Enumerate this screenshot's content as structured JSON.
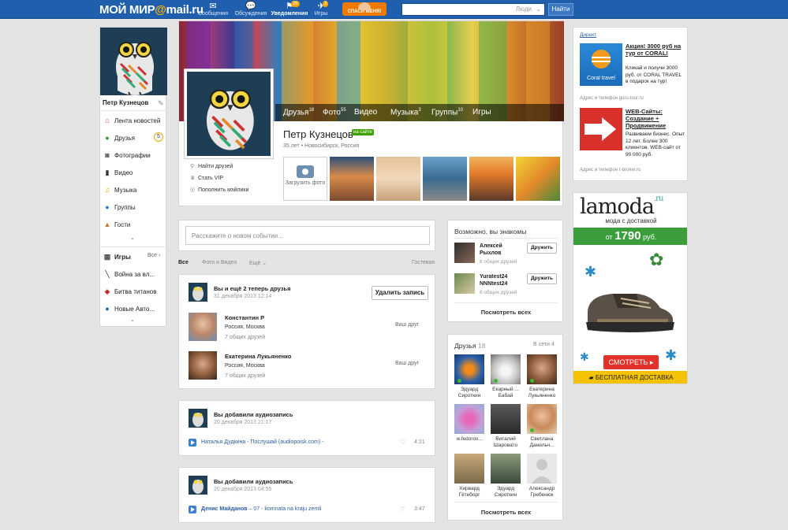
{
  "topbar": {
    "logo_text": "МОЙ МИР",
    "logo_at": "@",
    "logo_domain": "mail.ru",
    "nav": [
      {
        "label": "Сообщения",
        "icon": "message-icon",
        "count": ""
      },
      {
        "label": "Обсуждения",
        "icon": "discussion-icon",
        "count": ""
      },
      {
        "label": "Уведомления",
        "icon": "notification-icon",
        "count": "26"
      },
      {
        "label": "Игры",
        "icon": "games-icon",
        "count": "3"
      }
    ],
    "promo_label": "СПАСИ МЕНЯ!",
    "search_scope": "Люди",
    "search_button": "Найти"
  },
  "left": {
    "name": "Петр Кузнецов",
    "menu": [
      {
        "label": "Лента новостей",
        "icon": "house-icon"
      },
      {
        "label": "Друзья",
        "icon": "friends-icon",
        "count": "5"
      },
      {
        "label": "Фотографии",
        "icon": "camera-icon"
      },
      {
        "label": "Видео",
        "icon": "video-icon"
      },
      {
        "label": "Музыка",
        "icon": "music-icon"
      },
      {
        "label": "Группы",
        "icon": "groups-icon"
      },
      {
        "label": "Гости",
        "icon": "guests-icon"
      }
    ],
    "games_label": "Игры",
    "games_all": "Все",
    "games": [
      "Война за вл...",
      "Битва титанов",
      "Новые Авто..."
    ]
  },
  "profile": {
    "name": "Петр Кузнецов",
    "onsite": "на сайте",
    "info": "35 лет • Новосибирск, Россия",
    "upload_label": "Загрузить фото",
    "links": [
      "Найти друзей",
      "Стать VIP",
      "Пополнить мэйлики"
    ],
    "nav": [
      {
        "label": "Друзья",
        "count": "18"
      },
      {
        "label": "Фото",
        "count": "55"
      },
      {
        "label": "Видео",
        "count": ""
      },
      {
        "label": "Музыка",
        "count": "3"
      },
      {
        "label": "Группы",
        "count": "10"
      },
      {
        "label": "Игры",
        "count": ""
      }
    ]
  },
  "feed": {
    "post_placeholder": "Расскажите о новом событии...",
    "filters": [
      "Все",
      "Фото и Видео",
      "Ещё"
    ],
    "guestbook": "Гостевая",
    "event1": {
      "title": "Вы и ещё 2 теперь друзья",
      "date": "31 декабря 2013 12:14",
      "delete_button": "Удалить запись",
      "friends": [
        {
          "name": "Константин Р",
          "city": "Россия, Москва",
          "mutual": "7 общих друзей",
          "badge": "Ваш друг"
        },
        {
          "name": "Екатерина Лукьяненко",
          "city": "Россия, Москва",
          "mutual": "7 общих друзей",
          "badge": "Ваш друг"
        }
      ]
    },
    "event2": {
      "title": "Вы добавили аудиозапись",
      "date": "20 декабря 2013 21:17",
      "track_artist": "Наталья Дудкина",
      "track_title": " - Послушай (audiopoisk.com) -",
      "duration": "4:21"
    },
    "event3": {
      "title": "Вы добавили аудиозапись",
      "date": "20 декабря 2013 04:55",
      "track_artist": "Денис Майданов",
      "track_title": " – 07 - komnata na kraju zemli",
      "duration": "3:47"
    }
  },
  "known": {
    "title": "Возможно, вы знакомы",
    "people": [
      {
        "name1": "Алексей",
        "name2": "Рыхлов",
        "mutual": "8 общих друзей",
        "button": "Дружить"
      },
      {
        "name1": "Yuratest24",
        "name2": "NNNtest24",
        "mutual": "6 общих друзей",
        "button": "Дружить"
      }
    ],
    "see_all": "Посмотреть всех"
  },
  "friends_box": {
    "title": "Друзья",
    "count": "18",
    "online": "В сети 4",
    "items": [
      {
        "l1": "Эдуард",
        "l2": "Сироткин"
      },
      {
        "l1": "Екарный ...",
        "l2": "Бабай"
      },
      {
        "l1": "Екатерина",
        "l2": "Лукьяненко"
      },
      {
        "l1": "w.fedorov...",
        "l2": ""
      },
      {
        "l1": "Виталий",
        "l2": "Шаровато"
      },
      {
        "l1": "Светлана",
        "l2": "Данильч..."
      },
      {
        "l1": "Хирвард",
        "l2": "Гётеборг"
      },
      {
        "l1": "Эдуард",
        "l2": "Сироткин"
      },
      {
        "l1": "Александр",
        "l2": "Гребенюк"
      }
    ],
    "see_all": "Посмотреть всех"
  },
  "ads": {
    "direct": "Директ",
    "ad1": {
      "title": "Акция! 3000 руб на тур от CORAL!",
      "text": "Кликай и получи 3000 руб. от CORAL TRAVEL в подарок на тур!",
      "url": "Адрес и телефон  guru-tour.ru",
      "logo_text": "Coral travel"
    },
    "ad2": {
      "title": "WEB-Сайты: Создание + Продвижение",
      "text": "Развиваем бизнес. Опыт 12 лет. Более 300 клиентов. WEB-сайт от 90 000 руб.",
      "url": "Адрес и телефон  r-broker.ru"
    },
    "lamoda": {
      "brand": "lamoda",
      "ru": ".ru",
      "sub": "мода с доставкой",
      "price_prefix": "от",
      "price": "1790",
      "currency": "руб.",
      "button": "СМОТРЕТЬ ▸",
      "free": "БЕСПЛАТНАЯ ДОСТАВКА"
    }
  }
}
